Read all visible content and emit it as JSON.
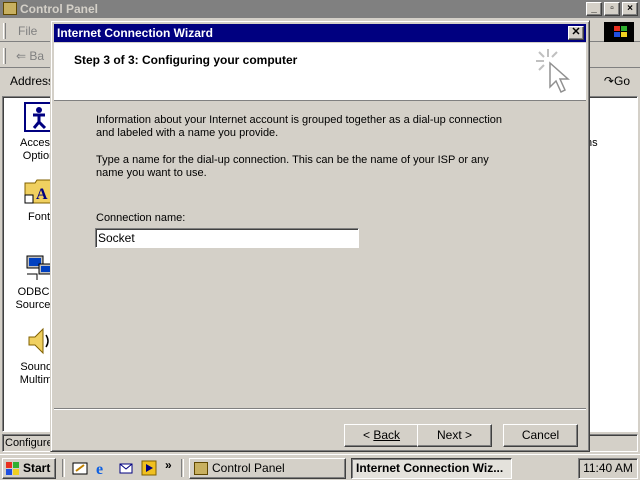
{
  "control_panel": {
    "title": "Control Panel",
    "menu_file": "File",
    "back_label": "Ba",
    "address_label": "Address",
    "go_label": "Go",
    "status": "Configure",
    "right_partial_text": "ns",
    "items": [
      {
        "label": "Accessi Option",
        "icon": "accessibility-icon"
      },
      {
        "label": "Font",
        "icon": "fonts-folder-icon"
      },
      {
        "label": "ODBC D Sources (",
        "icon": "odbc-icon"
      },
      {
        "label": "Sounds Multime",
        "icon": "sounds-icon"
      }
    ]
  },
  "wizard": {
    "title": "Internet Connection Wizard",
    "step": "Step 3 of 3: Configuring your computer",
    "para1": "Information about your Internet account is grouped together as a dial-up connection and labeled with a name you provide.",
    "para2": "Type a name for the dial-up connection. This can be the name of your ISP or any name you want to use.",
    "connection_label": "Connection name:",
    "connection_value": "Socket",
    "back_button": "Back",
    "next_button": "Next >",
    "cancel_button": "Cancel"
  },
  "taskbar": {
    "start_label": "Start",
    "task_control_panel": "Control Panel",
    "task_wizard": "Internet Connection Wiz...",
    "chevron": "»",
    "clock": "11:40 AM"
  },
  "colors": {
    "title_active": "#000080",
    "title_inactive": "#808080",
    "face": "#d4d0c8"
  }
}
